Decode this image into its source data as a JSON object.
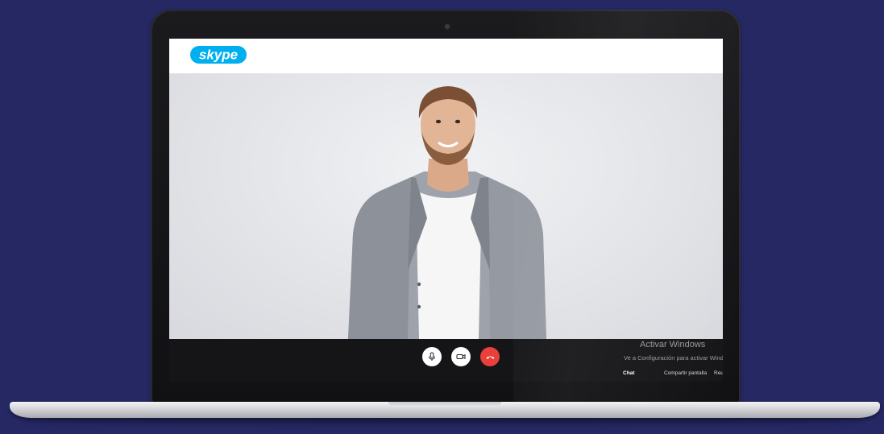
{
  "app": {
    "logo_text": "skype",
    "brand_color": "#00aff0"
  },
  "call_controls": {
    "mic_icon": "microphone-icon",
    "video_icon": "video-camera-icon",
    "hangup_icon": "phone-hangup-icon",
    "hangup_color": "#e8403b"
  },
  "call_bar": {
    "tabs": [
      "Chat",
      "Compartir pantalla",
      "Reu"
    ]
  },
  "watermark": {
    "title": "Activar Windows",
    "subtitle": "Ve a Configuración para activar Windows."
  },
  "colors": {
    "background": "#262864",
    "laptop_body": "#141417",
    "call_bar": "#151517"
  }
}
